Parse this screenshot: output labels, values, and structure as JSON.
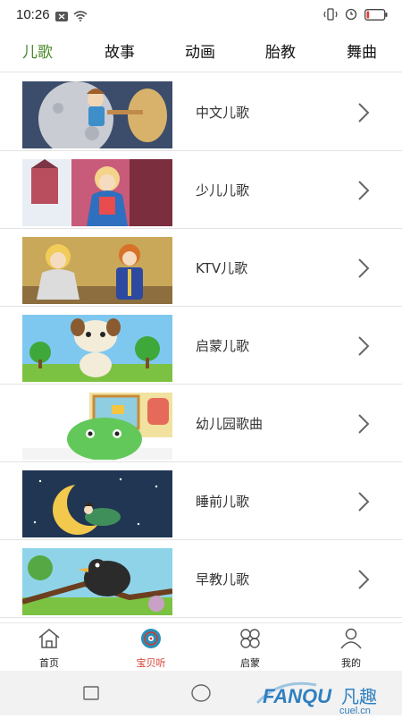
{
  "status_bar": {
    "time": "10:26",
    "battery_level": 0.15,
    "battery_color": "#e53935"
  },
  "tabs": [
    {
      "label": "儿歌",
      "active": true
    },
    {
      "label": "故事",
      "active": false
    },
    {
      "label": "动画",
      "active": false
    },
    {
      "label": "胎教",
      "active": false
    },
    {
      "label": "舞曲",
      "active": false
    }
  ],
  "colors": {
    "active_tab": "#4a8a2a",
    "active_nav": "#d23b2a"
  },
  "list": [
    {
      "title": "中文儿歌",
      "thumb": "girl-on-moon-illustration"
    },
    {
      "title": "少儿儿歌",
      "thumb": "blonde-girl-castle-illustration"
    },
    {
      "title": "KTV儿歌",
      "thumb": "cinderella-prince-illustration"
    },
    {
      "title": "启蒙儿歌",
      "thumb": "cartoon-dog-illustration"
    },
    {
      "title": "幼儿园歌曲",
      "thumb": "green-monster-illustration"
    },
    {
      "title": "睡前儿歌",
      "thumb": "child-on-crescent-moon-illustration"
    },
    {
      "title": "早教儿歌",
      "thumb": "crow-on-branch-illustration"
    }
  ],
  "bottom_nav": [
    {
      "label": "首页",
      "icon": "home-icon",
      "active": false
    },
    {
      "label": "宝贝听",
      "icon": "disc-icon",
      "active": true
    },
    {
      "label": "启蒙",
      "icon": "grid-petals-icon",
      "active": false
    },
    {
      "label": "我的",
      "icon": "user-icon",
      "active": false
    }
  ],
  "watermark": {
    "brand": "FANQU",
    "brand_cn": "凡趣",
    "domain": "cuel.cn"
  }
}
